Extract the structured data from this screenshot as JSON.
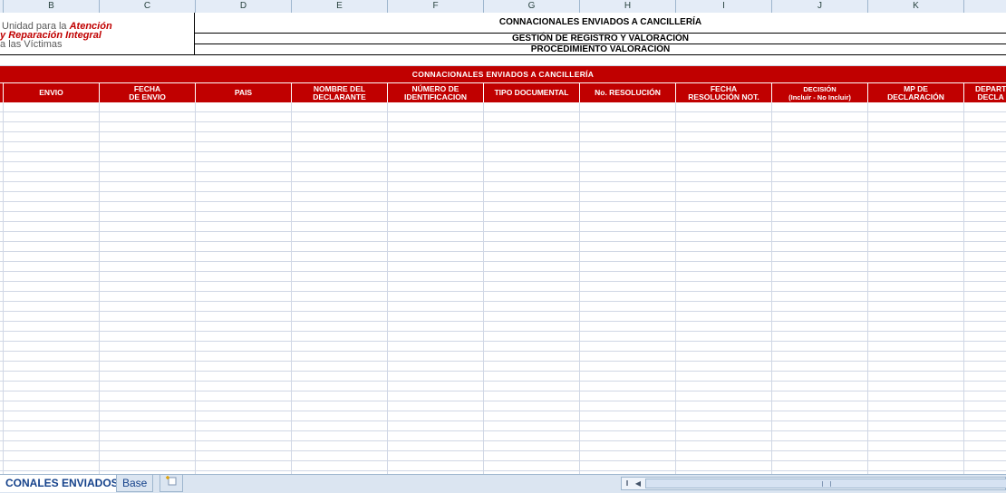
{
  "column_letters": [
    "B",
    "C",
    "D",
    "E",
    "F",
    "G",
    "H",
    "I",
    "J",
    "K"
  ],
  "logo": {
    "line1_grey": "Unidad para la ",
    "line1_red": "Atención",
    "line2_red": "Reparación Integral",
    "line3_grey": "las Víctimas"
  },
  "report_header": {
    "title": "CONNACIONALES ENVIADOS A CANCILLERÍA",
    "subtitle": "GESTIÓN DE REGISTRO Y VALORACIÓN",
    "procedure": "PROCEDIMIENTO VALORACIÓN"
  },
  "table": {
    "band_title": "CONNACIONALES ENVIADOS A CANCILLERÍA",
    "columns": [
      "ENVIO",
      "FECHA\nDE ENVIO",
      "PAIS",
      "NOMBRE DEL\nDECLARANTE",
      "NÚMERO DE\nIDENTIFICACION",
      "TIPO DOCUMENTAL",
      "No. RESOLUCIÓN",
      "FECHA\nRESOLUCIÓN NOT.",
      "DECISIÓN\n(Incluir - No Incluir)",
      "MP DE\nDECLARACIÓN",
      "DEPART\nDECLA"
    ]
  },
  "sheet_tabs": {
    "active": "CONALES ENVIADOS",
    "other": "Base"
  },
  "colors": {
    "accent_red": "#c00000",
    "header_blue": "#e4ecf7",
    "gridline": "#d0d7e5"
  }
}
